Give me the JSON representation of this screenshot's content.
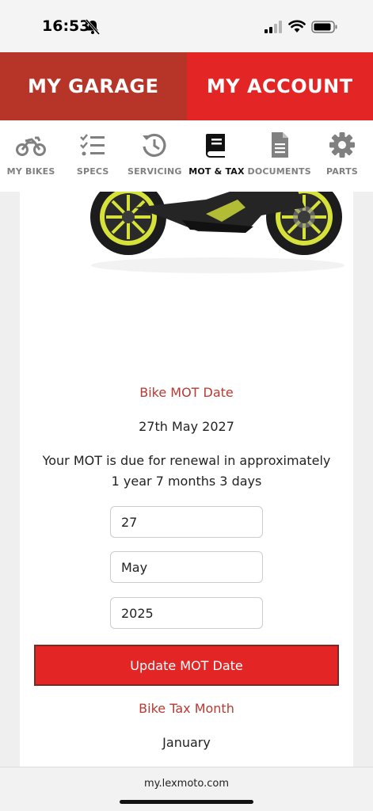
{
  "status_bar": {
    "time": "16:53",
    "icons": [
      "bell-slash-icon",
      "signal-icon",
      "wifi-icon",
      "battery-icon"
    ]
  },
  "top_tabs": [
    {
      "label": "MY GARAGE",
      "color": "#b73428"
    },
    {
      "label": "MY ACCOUNT",
      "color": "#e32625"
    }
  ],
  "nav": [
    {
      "label": "MY BIKES",
      "icon": "motorcycle-icon"
    },
    {
      "label": "SPECS",
      "icon": "checklist-icon"
    },
    {
      "label": "SERVICING",
      "icon": "history-icon"
    },
    {
      "label": "MOT & TAX",
      "icon": "book-icon",
      "active": true
    },
    {
      "label": "DOCUMENTS",
      "icon": "document-icon"
    },
    {
      "label": "PARTS",
      "icon": "gear-icon"
    }
  ],
  "mot": {
    "label": "Bike MOT Date",
    "date": "27th May 2027",
    "due_line1": "Your MOT is due for renewal in approximately",
    "due_line2": "1 year 7 months 3 days",
    "day": "27",
    "month": "May",
    "year": "2025",
    "update_button": "Update MOT Date"
  },
  "tax": {
    "label": "Bike Tax Month",
    "month": "January"
  },
  "browser": {
    "url": "my.lexmoto.com"
  },
  "colors": {
    "accent_red": "#e32625",
    "dark_red": "#b73428",
    "label_red": "#b83a32"
  }
}
